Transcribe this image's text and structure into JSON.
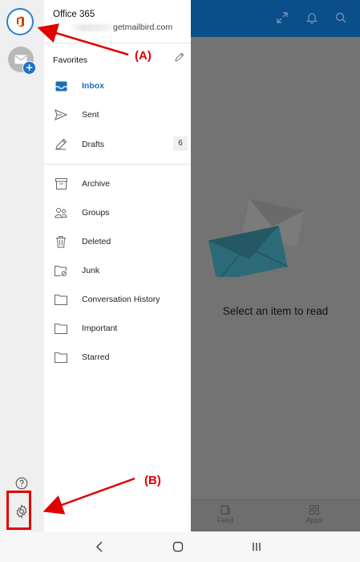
{
  "header": {
    "expand_icon": "expand-icon",
    "bell_icon": "bell-icon",
    "search_icon": "search-icon"
  },
  "reading_pane": {
    "empty_message": "Select an item to read"
  },
  "bottom_tabs": [
    {
      "label": "Feed",
      "icon": "feed-icon"
    },
    {
      "label": "Apps",
      "icon": "apps-icon"
    }
  ],
  "account": {
    "name": "Office 365",
    "email_suffix": "getmailbird.com"
  },
  "favorites": {
    "label": "Favorites"
  },
  "folders_primary": [
    {
      "label": "Inbox",
      "icon": "inbox-icon",
      "active": true
    },
    {
      "label": "Sent",
      "icon": "sent-icon"
    },
    {
      "label": "Drafts",
      "icon": "drafts-icon",
      "count": "6"
    }
  ],
  "folders_secondary": [
    {
      "label": "Archive",
      "icon": "archive-icon"
    },
    {
      "label": "Groups",
      "icon": "groups-icon"
    },
    {
      "label": "Deleted",
      "icon": "trash-icon"
    },
    {
      "label": "Junk",
      "icon": "junk-icon"
    },
    {
      "label": "Conversation History",
      "icon": "folder-icon"
    },
    {
      "label": "Important",
      "icon": "folder-icon"
    },
    {
      "label": "Starred",
      "icon": "folder-icon"
    }
  ],
  "annotations": {
    "a": "(A)",
    "b": "(B)"
  },
  "colors": {
    "accent": "#1a6fba",
    "header": "#0a4e8a",
    "annotation": "#e00000"
  }
}
